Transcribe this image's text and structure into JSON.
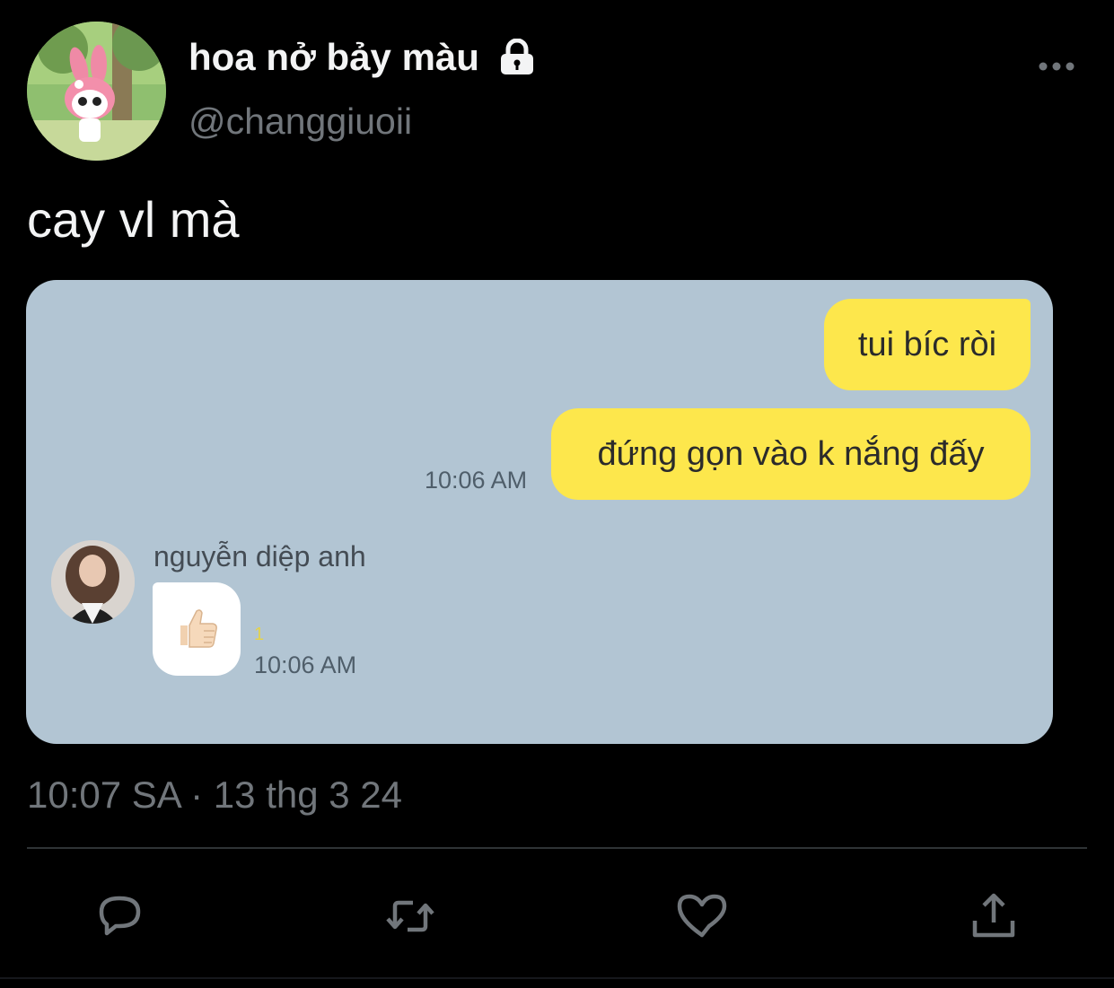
{
  "user": {
    "display_name": "hoa nở bảy màu",
    "handle": "@changgiuoii",
    "protected": true
  },
  "tweet": {
    "text": "cay vl mà",
    "timestamp": "10:07 SA · 13 thg 3 24"
  },
  "media": {
    "messages_sent": [
      {
        "text": "tui bíc ròi"
      },
      {
        "text": "đứng gọn vào k nắng đấy"
      }
    ],
    "sent_time": "10:06 AM",
    "friend": {
      "name": "nguyễn diệp anh",
      "read_count": "1",
      "time": "10:06 AM"
    },
    "colors": {
      "chat_background": "#b2c5d3",
      "my_bubble": "#fde74c",
      "friend_bubble": "#ffffff"
    }
  },
  "actions": {
    "reply_icon": "reply-icon",
    "retweet_icon": "retweet-icon",
    "like_icon": "heart-icon",
    "share_icon": "share-icon"
  },
  "theme": {
    "background": "#000000",
    "primary_text": "#e7e9ea",
    "secondary_text": "#71767b"
  }
}
